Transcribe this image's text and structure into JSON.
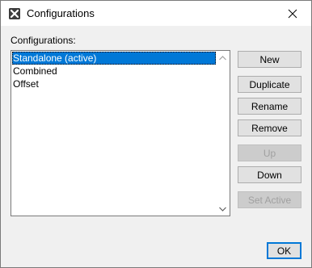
{
  "window": {
    "title": "Configurations"
  },
  "list_label": "Configurations:",
  "configurations": [
    {
      "label": "Standalone (active)",
      "selected": true
    },
    {
      "label": "Combined",
      "selected": false
    },
    {
      "label": "Offset",
      "selected": false
    }
  ],
  "buttons": {
    "new": {
      "label": "New",
      "enabled": true
    },
    "duplicate": {
      "label": "Duplicate",
      "enabled": true
    },
    "rename": {
      "label": "Rename",
      "enabled": true
    },
    "remove": {
      "label": "Remove",
      "enabled": true
    },
    "up": {
      "label": "Up",
      "enabled": false
    },
    "down": {
      "label": "Down",
      "enabled": true
    },
    "set_active": {
      "label": "Set Active",
      "enabled": false
    },
    "ok": {
      "label": "OK",
      "enabled": true
    }
  },
  "colors": {
    "selection": "#0078d7",
    "default_button_border": "#0078d7",
    "disabled_text": "#a0a0a0"
  }
}
